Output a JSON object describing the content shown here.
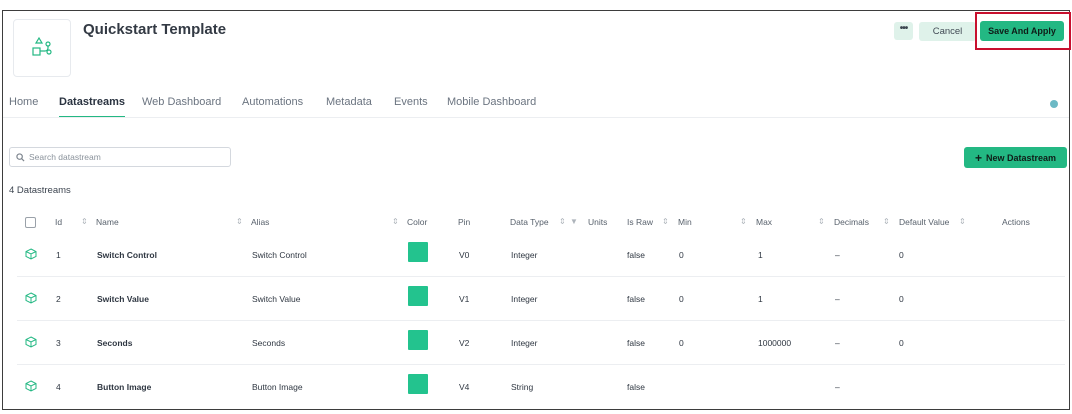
{
  "header": {
    "title": "Quickstart Template",
    "more_label": "•••",
    "cancel_label": "Cancel",
    "save_label": "Save And Apply"
  },
  "tabs": [
    {
      "label": "Home"
    },
    {
      "label": "Datastreams",
      "active": true
    },
    {
      "label": "Web Dashboard"
    },
    {
      "label": "Automations"
    },
    {
      "label": "Metadata"
    },
    {
      "label": "Events"
    },
    {
      "label": "Mobile Dashboard"
    }
  ],
  "search": {
    "placeholder": "Search datastream"
  },
  "new_button": {
    "label": "New Datastream",
    "icon": "+"
  },
  "count_text": "4 Datastreams",
  "colors": {
    "accent": "#23b883",
    "swatch": "#23c38e",
    "highlight": "#c8102e"
  },
  "table": {
    "columns": [
      "Id",
      "Name",
      "Alias",
      "Color",
      "Pin",
      "Data Type",
      "Units",
      "Is Raw",
      "Min",
      "Max",
      "Decimals",
      "Default Value",
      "Actions"
    ],
    "rows": [
      {
        "id": "1",
        "name": "Switch Control",
        "alias": "Switch Control",
        "pin": "V0",
        "type": "Integer",
        "raw": "false",
        "min": "0",
        "max": "1",
        "decimals": "–",
        "default": "0"
      },
      {
        "id": "2",
        "name": "Switch Value",
        "alias": "Switch Value",
        "pin": "V1",
        "type": "Integer",
        "raw": "false",
        "min": "0",
        "max": "1",
        "decimals": "–",
        "default": "0"
      },
      {
        "id": "3",
        "name": "Seconds",
        "alias": "Seconds",
        "pin": "V2",
        "type": "Integer",
        "raw": "false",
        "min": "0",
        "max": "1000000",
        "decimals": "–",
        "default": "0"
      },
      {
        "id": "4",
        "name": "Button Image",
        "alias": "Button Image",
        "pin": "V4",
        "type": "String",
        "raw": "false",
        "min": "",
        "max": "",
        "decimals": "–",
        "default": ""
      }
    ]
  }
}
